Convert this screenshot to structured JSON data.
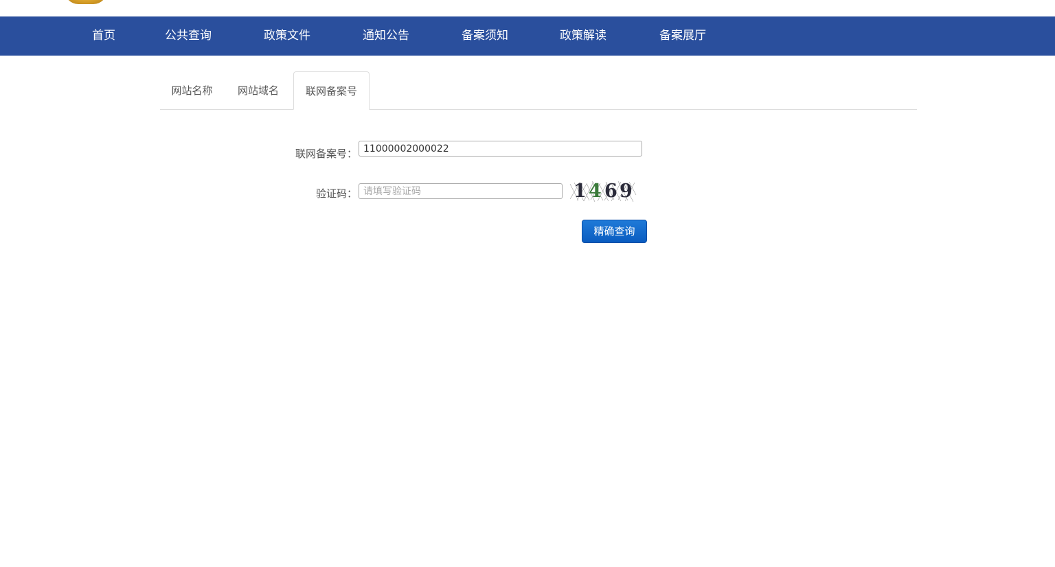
{
  "nav": {
    "items": [
      {
        "label": "首页"
      },
      {
        "label": "公共查询"
      },
      {
        "label": "政策文件"
      },
      {
        "label": "通知公告"
      },
      {
        "label": "备案须知"
      },
      {
        "label": "政策解读"
      },
      {
        "label": "备案展厅"
      }
    ],
    "background_color": "#2a4f9d"
  },
  "tabs": {
    "items": [
      {
        "label": "网站名称",
        "active": false
      },
      {
        "label": "网站域名",
        "active": false
      },
      {
        "label": "联网备案号",
        "active": true
      }
    ]
  },
  "form": {
    "record_number": {
      "label": "联网备案号：",
      "value": "11000002000022"
    },
    "captcha": {
      "label": "验证码：",
      "placeholder": "请填写验证码",
      "value": "",
      "image_text": "1469"
    },
    "submit_label": "精确查询",
    "submit_color": "#0a5cc0"
  }
}
